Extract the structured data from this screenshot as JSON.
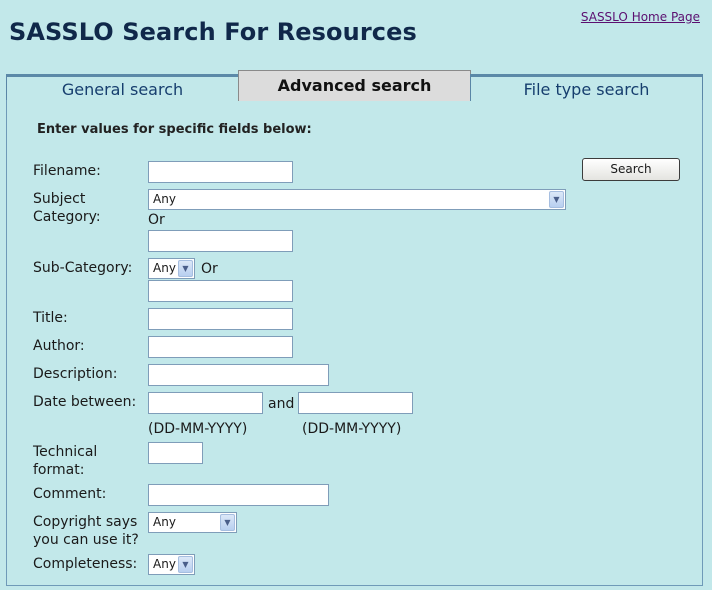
{
  "header": {
    "title": "SASSLO Search For Resources",
    "home_link": "SASSLO Home Page"
  },
  "tabs": [
    {
      "label": "General search",
      "active": false
    },
    {
      "label": "Advanced search",
      "active": true
    },
    {
      "label": "File type search",
      "active": false
    }
  ],
  "form": {
    "intro": "Enter values for specific fields below:",
    "search_button": "Search",
    "filename_label": "Filename:",
    "subject_label_1": "Subject",
    "subject_label_2": "Category:",
    "subject_value": "Any",
    "or_text": "Or",
    "subcategory_label": "Sub-Category:",
    "subcategory_value": "Any",
    "title_label": "Title:",
    "author_label": "Author:",
    "description_label": "Description:",
    "date_label": "Date between:",
    "date_and": "and",
    "date_format_1": "(DD-MM-YYYY)",
    "date_format_2": "(DD-MM-YYYY)",
    "technical_label_1": "Technical",
    "technical_label_2": "format:",
    "comment_label": "Comment:",
    "copyright_label_1": "Copyright says",
    "copyright_label_2": "you can use it?",
    "copyright_value": "Any",
    "completeness_label": "Completeness:",
    "completeness_value": "Any"
  }
}
